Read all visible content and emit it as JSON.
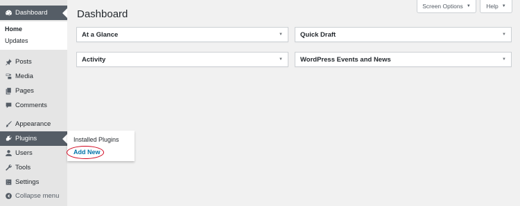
{
  "sidebar": {
    "dashboard": {
      "label": "Dashboard",
      "icon": "dashboard-icon"
    },
    "submenu": [
      {
        "label": "Home",
        "active": true
      },
      {
        "label": "Updates",
        "active": false
      }
    ],
    "items": [
      {
        "label": "Posts",
        "icon": "pushpin-icon"
      },
      {
        "label": "Media",
        "icon": "media-icon"
      },
      {
        "label": "Pages",
        "icon": "pages-icon"
      },
      {
        "label": "Comments",
        "icon": "comments-icon"
      },
      {
        "label": "Appearance",
        "icon": "paintbrush-icon"
      },
      {
        "label": "Plugins",
        "icon": "plugins-icon"
      },
      {
        "label": "Users",
        "icon": "users-icon"
      },
      {
        "label": "Tools",
        "icon": "wrench-icon"
      },
      {
        "label": "Settings",
        "icon": "settings-icon"
      },
      {
        "label": "Collapse menu",
        "icon": "collapse-icon"
      }
    ]
  },
  "flyout": {
    "items": [
      {
        "label": "Installed Plugins"
      },
      {
        "label": "Add New"
      }
    ]
  },
  "header": {
    "title": "Dashboard",
    "screen_options": "Screen Options",
    "help": "Help"
  },
  "widgets": [
    {
      "title": "At a Glance"
    },
    {
      "title": "Quick Draft"
    },
    {
      "title": "Activity"
    },
    {
      "title": "WordPress Events and News"
    }
  ],
  "colors": {
    "sidebar_bg": "#e5e5e5",
    "active_item_bg": "#555d66",
    "link_blue": "#0073aa",
    "annotation_red": "#d0021b"
  }
}
